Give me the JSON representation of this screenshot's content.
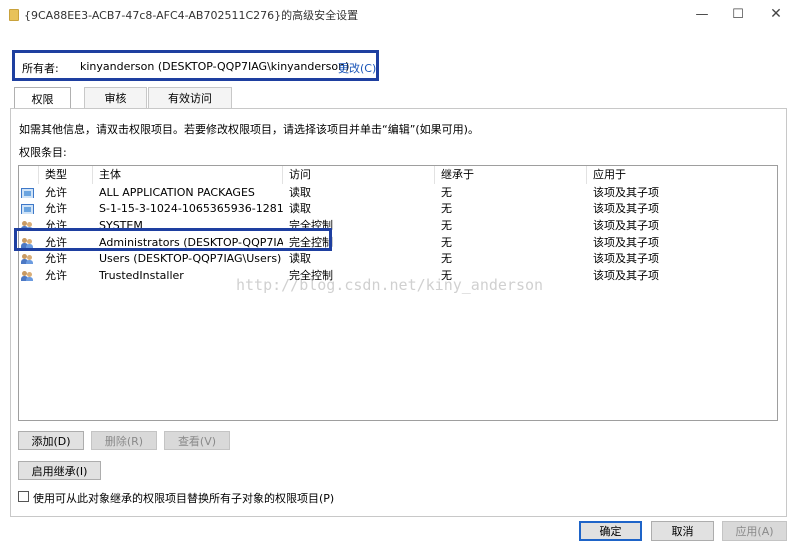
{
  "window": {
    "title": "{9CA88EE3-ACB7-47c8-AFC4-AB702511C276}的高级安全设置",
    "minimize": "—",
    "maximize": "☐",
    "close": "✕"
  },
  "owner": {
    "label": "所有者:",
    "value": "kinyanderson (DESKTOP-QQP7IAG\\kinyanderson)",
    "change_link": "更改(C)"
  },
  "tabs": [
    {
      "label": "权限",
      "active": true
    },
    {
      "label": "审核",
      "active": false
    },
    {
      "label": "有效访问",
      "active": false
    }
  ],
  "permissions": {
    "hint": "如需其他信息，请双击权限项目。若要修改权限项目，请选择该项目并单击“编辑”(如果可用)。",
    "entries_label": "权限条目:",
    "columns": [
      "类型",
      "主体",
      "访问",
      "继承于",
      "应用于"
    ],
    "rows": [
      {
        "icon": "package-icon",
        "type": "允许",
        "principal": "ALL APPLICATION PACKAGES",
        "access": "读取",
        "inherited_from": "无",
        "applies_to": "该项及其子项"
      },
      {
        "icon": "package-icon",
        "type": "允许",
        "principal": "S-1-15-3-1024-1065365936-1281...",
        "access": "读取",
        "inherited_from": "无",
        "applies_to": "该项及其子项"
      },
      {
        "icon": "users-icon",
        "type": "允许",
        "principal": "SYSTEM",
        "access": "完全控制",
        "inherited_from": "无",
        "applies_to": "该项及其子项"
      },
      {
        "icon": "users-icon",
        "type": "允许",
        "principal": "Administrators (DESKTOP-QQP7IA...",
        "access": "完全控制",
        "inherited_from": "无",
        "applies_to": "该项及其子项"
      },
      {
        "icon": "users-icon",
        "type": "允许",
        "principal": "Users (DESKTOP-QQP7IAG\\Users)",
        "access": "读取",
        "inherited_from": "无",
        "applies_to": "该项及其子项"
      },
      {
        "icon": "users-icon",
        "type": "允许",
        "principal": "TrustedInstaller",
        "access": "完全控制",
        "inherited_from": "无",
        "applies_to": "该项及其子项"
      }
    ]
  },
  "watermark": "http://blog.csdn.net/kiny_anderson",
  "buttons": {
    "add": "添加(D)",
    "remove": "删除(R)",
    "view": "查看(V)",
    "enable_inheritance": "启用继承(I)",
    "ok": "确定",
    "cancel": "取消",
    "apply": "应用(A)"
  },
  "replace_child_checkbox": {
    "label": "使用可从此对象继承的权限项目替换所有子对象的权限项目(P)",
    "checked": false
  },
  "colors": {
    "annotation_box": "#1e3fa0",
    "link": "#1a55b8"
  }
}
